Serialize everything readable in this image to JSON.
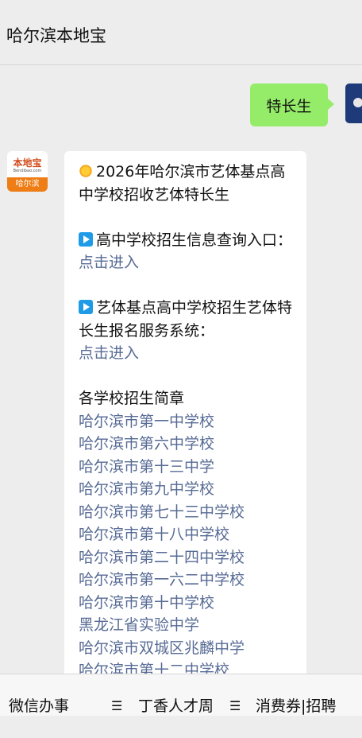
{
  "header": {
    "title": "哈尔滨本地宝"
  },
  "chat": {
    "user_message": "特长生",
    "bot_avatar": {
      "logo_text": "本地宝",
      "logo_sub": "Bendibao.com",
      "city": "哈尔滨"
    },
    "reply": {
      "headline": "2026年哈尔滨市艺体基点高中学校招收艺体特长生",
      "item1_text": "高中学校招生信息查询入口：",
      "item1_link": "点击进入",
      "item2_text": "艺体基点高中学校招生艺体特长生报名服务系统：",
      "item2_link": "点击进入",
      "section_title": "各学校招生简章",
      "schools": [
        "哈尔滨市第一中学校",
        "哈尔滨市第六中学校",
        "哈尔滨市第十三中学",
        "哈尔滨市第九中学校",
        "哈尔滨市第七十三中学校",
        "哈尔滨市第十八中学校",
        "哈尔滨市第二十四中学校",
        "哈尔滨市第一六二中学校",
        "哈尔滨市第十中学校",
        "黑龙江省实验中学",
        "哈尔滨市双城区兆麟中学",
        "哈尔滨市第十二中学校"
      ]
    }
  },
  "bottom_menu": [
    {
      "label": "微信办事",
      "icon": "menu-icon"
    },
    {
      "label": "丁香人才周",
      "icon": "menu-icon"
    },
    {
      "label": "消费券|招聘",
      "icon": "menu-icon"
    }
  ],
  "colors": {
    "user_bubble": "#95ec69",
    "link": "#576b95",
    "logo_band": "#ef7d16"
  }
}
